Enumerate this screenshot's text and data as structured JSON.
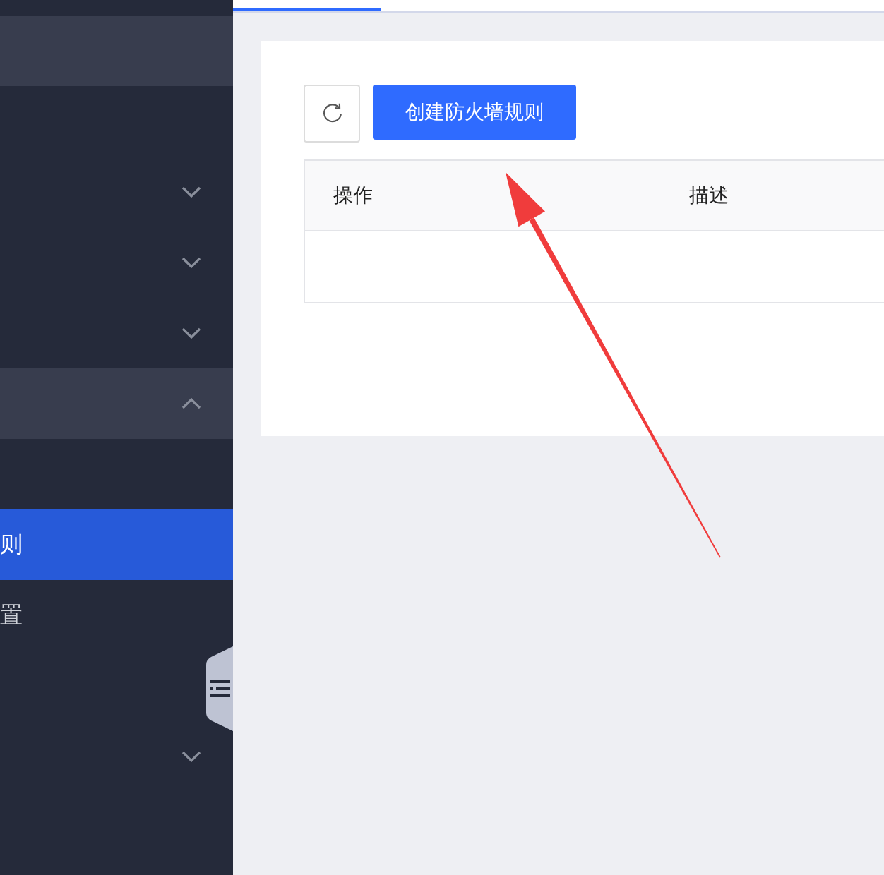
{
  "sidebar": {
    "items": [
      {
        "kind": "title"
      },
      {
        "kind": "item",
        "selected": false
      },
      {
        "kind": "group",
        "expanded": false
      },
      {
        "kind": "group",
        "expanded": false
      },
      {
        "kind": "group",
        "expanded": false
      },
      {
        "kind": "group",
        "expanded": true,
        "children": [
          {
            "kind": "item",
            "selected": false
          },
          {
            "kind": "item",
            "label": "则",
            "selected": true
          },
          {
            "kind": "item",
            "label": "置",
            "selected": false
          }
        ]
      },
      {
        "kind": "item",
        "selected": false
      },
      {
        "kind": "group",
        "expanded": false
      }
    ]
  },
  "tabs": [
    {
      "selected": true
    }
  ],
  "toolbar": {
    "buttons": [
      {
        "kind": "refresh"
      },
      {
        "kind": "primary",
        "label": "创建防火墙规则"
      }
    ]
  },
  "table": {
    "columns": [
      "操作",
      "描述"
    ]
  }
}
